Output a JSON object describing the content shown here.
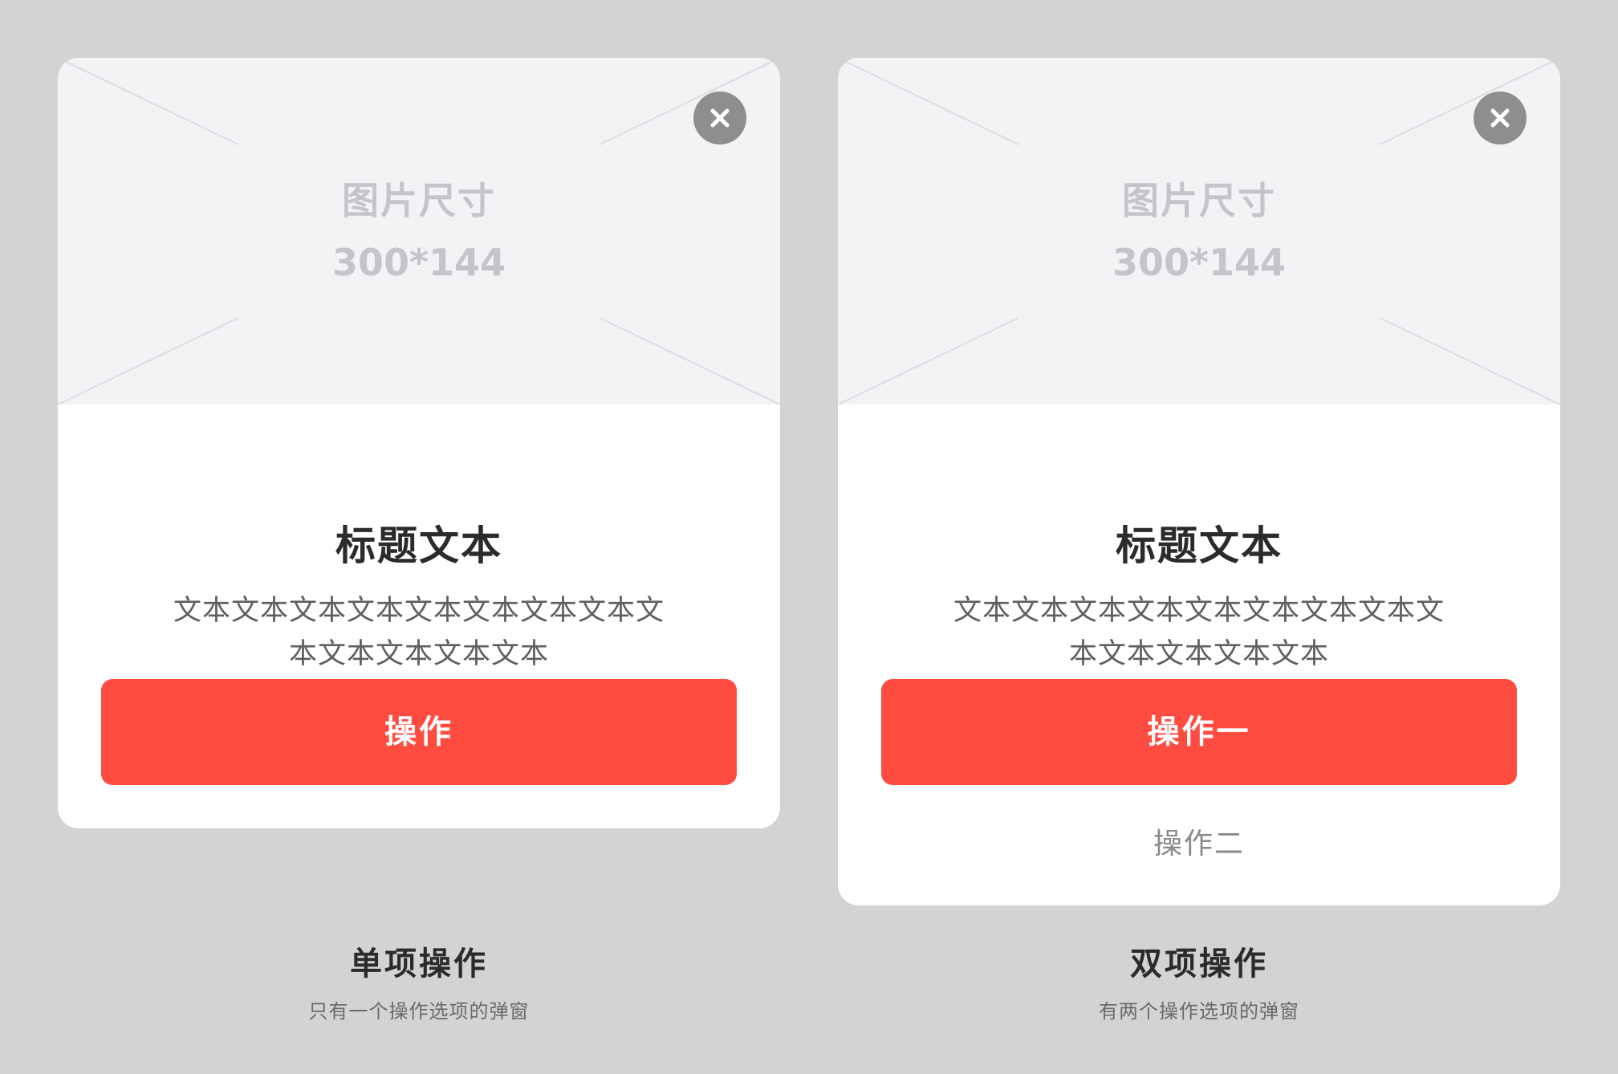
{
  "colors": {
    "background": "#d3d3d3",
    "card": "#ffffff",
    "placeholder": "#f2f3f5",
    "placeholder_text": "#c4c5c9",
    "primary_button": "#fe4d40",
    "close_button": "#8e8e8e"
  },
  "dialogs": [
    {
      "image": {
        "label": "图片尺寸",
        "size": "300*144"
      },
      "close_icon": "close-icon",
      "title": "标题文本",
      "body_line1": "文本文本文本文本文本文本文本文本文",
      "body_line2": "本文本文本文本文本",
      "primary_label": "操作",
      "caption_title": "单项操作",
      "caption_subtitle": "只有一个操作选项的弹窗"
    },
    {
      "image": {
        "label": "图片尺寸",
        "size": "300*144"
      },
      "close_icon": "close-icon",
      "title": "标题文本",
      "body_line1": "文本文本文本文本文本文本文本文本文",
      "body_line2": "本文本文本文本文本",
      "primary_label": "操作一",
      "secondary_label": "操作二",
      "caption_title": "双项操作",
      "caption_subtitle": "有两个操作选项的弹窗"
    }
  ]
}
